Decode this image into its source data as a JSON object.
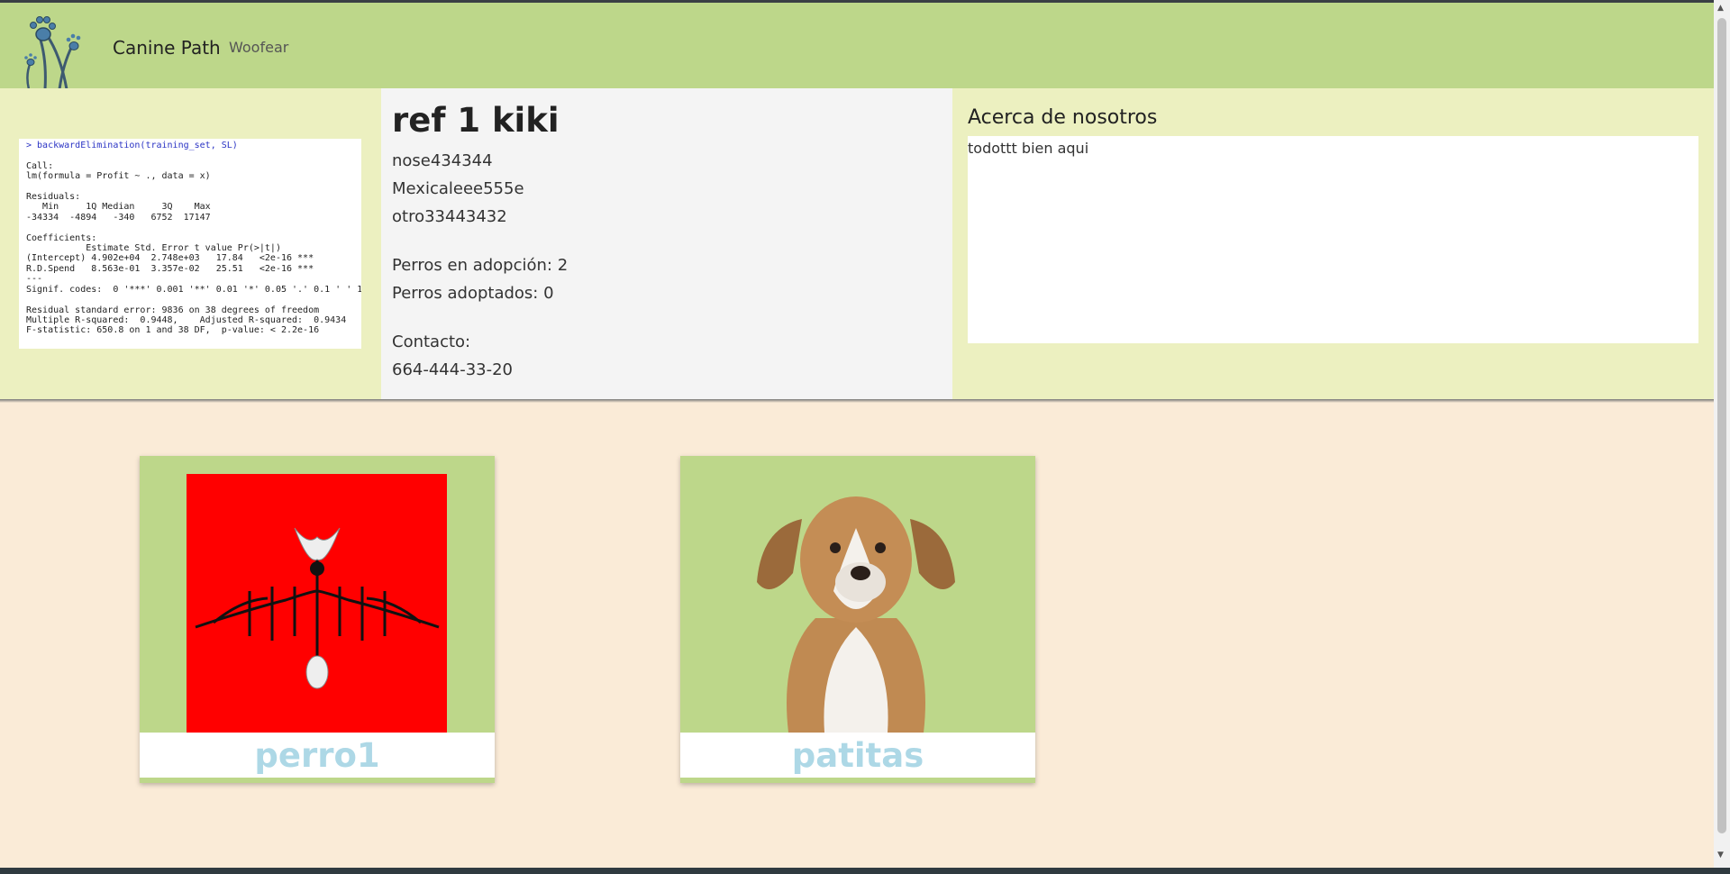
{
  "colors": {
    "navbar": "#bdd78a",
    "band": "#ecf0c0",
    "page": "#faebd7",
    "dog_name": "#add8e6"
  },
  "navbar": {
    "brand": "Canine Path",
    "link": "Woofear",
    "logo_icon": "paw-prints-logo"
  },
  "code_panel": {
    "lines": [
      "> backwardElimination(training_set, SL)",
      "",
      "Call:",
      "lm(formula = Profit ~ ., data = x)",
      "",
      "Residuals:",
      "   Min     1Q Median     3Q    Max",
      "-34334  -4894   -340   6752  17147",
      "",
      "Coefficients:",
      "           Estimate Std. Error t value Pr(>|t|)",
      "(Intercept) 4.902e+04  2.748e+03   17.84   <2e-16 ***",
      "R.D.Spend   8.563e-01  3.357e-02   25.51   <2e-16 ***",
      "---",
      "Signif. codes:  0 '***' 0.001 '**' 0.01 '*' 0.05 '.' 0.1 ' ' 1",
      "",
      "Residual standard error: 9836 on 38 degrees of freedom",
      "Multiple R-squared:  0.9448,    Adjusted R-squared:  0.9434",
      "F-statistic: 650.8 on 1 and 38 DF,  p-value: < 2.2e-16"
    ]
  },
  "shelter": {
    "title": "ref 1 kiki",
    "line1": "nose434344",
    "line2": "Mexicaleee555e",
    "line3": "otro33443432",
    "in_adoption": "Perros en adopción: 2",
    "adopted": "Perros adoptados: 0",
    "contact_label": "Contacto:",
    "phone": "664-444-33-20"
  },
  "about": {
    "title": "Acerca de nosotros",
    "text": "todottt bien aqui"
  },
  "dogs": [
    {
      "name": "perro1",
      "image": "red-abstract-art"
    },
    {
      "name": "patitas",
      "image": "puppy-photo"
    }
  ]
}
